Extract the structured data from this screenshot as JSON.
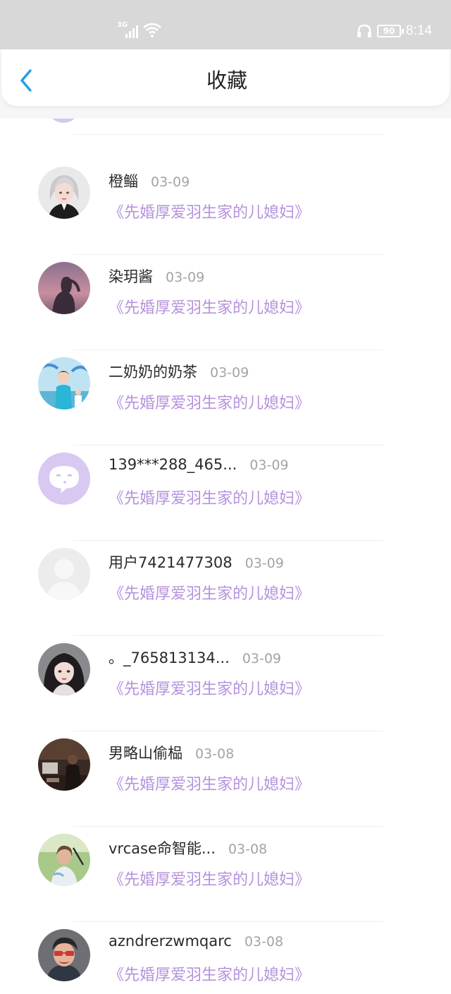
{
  "status_bar": {
    "network": "3G",
    "battery": "90",
    "time": "8:14"
  },
  "header": {
    "title": "收藏"
  },
  "items": [
    {
      "name": "橙鲻",
      "date": "03-09",
      "book": "《先婚厚爱羽生家的儿媳妇》",
      "avatar": "avatar-silver-hair-girl"
    },
    {
      "name": "染玥酱",
      "date": "03-09",
      "book": "《先婚厚爱羽生家的儿媳妇》",
      "avatar": "avatar-sunset-silhouette"
    },
    {
      "name": "二奶奶的奶茶",
      "date": "03-09",
      "book": "《先婚厚爱羽生家的儿媳妇》",
      "avatar": "avatar-skater-blue"
    },
    {
      "name": "139***288_465...",
      "date": "03-09",
      "book": "《先婚厚爱羽生家的儿媳妇》",
      "avatar": "avatar-default-chat-bubble"
    },
    {
      "name": "用户7421477308",
      "date": "03-09",
      "book": "《先婚厚爱羽生家的儿媳妇》",
      "avatar": "avatar-default-person"
    },
    {
      "name": "。_765813134...",
      "date": "03-09",
      "book": "《先婚厚爱羽生家的儿媳妇》",
      "avatar": "avatar-anime-girl"
    },
    {
      "name": "男略山偷榀",
      "date": "03-08",
      "book": "《先婚厚爱羽生家的儿媳妇》",
      "avatar": "avatar-desk-photo"
    },
    {
      "name": "vrcase命智能...",
      "date": "03-08",
      "book": "《先婚厚爱羽生家的儿媳妇》",
      "avatar": "avatar-tennis-player"
    },
    {
      "name": "azndrerzwmqarc",
      "date": "03-08",
      "book": "《先婚厚爱羽生家的儿媳妇》",
      "avatar": "avatar-cartoon-man"
    }
  ],
  "colors": {
    "accent_blue": "#2a9ae8",
    "book_purple": "#b592dc",
    "status_gray": "#d8d8d8"
  }
}
